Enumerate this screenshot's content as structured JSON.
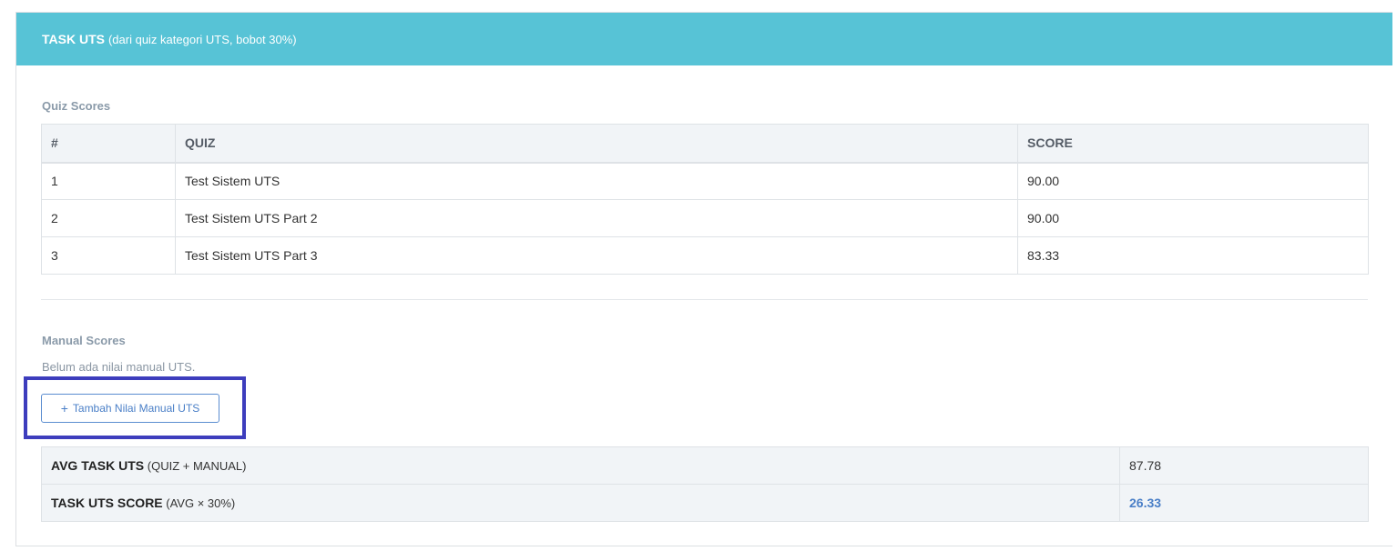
{
  "header": {
    "title": "TASK UTS",
    "subtitle": "(dari quiz kategori UTS, bobot 30%)",
    "color": "#57c3d6"
  },
  "quiz_section": {
    "label": "Quiz Scores",
    "columns": [
      "#",
      "QUIZ",
      "SCORE"
    ],
    "rows": [
      {
        "no": "1",
        "quiz": "Test Sistem UTS",
        "score": "90.00"
      },
      {
        "no": "2",
        "quiz": "Test Sistem UTS Part 2",
        "score": "90.00"
      },
      {
        "no": "3",
        "quiz": "Test Sistem UTS Part 3",
        "score": "83.33"
      }
    ]
  },
  "manual_section": {
    "label": "Manual Scores",
    "empty_text": "Belum ada nilai manual UTS.",
    "add_button_icon": "plus-icon",
    "add_button_label": "Tambah Nilai Manual UTS"
  },
  "summary": {
    "avg_label": "AVG TASK UTS",
    "avg_note": "(QUIZ + MANUAL)",
    "avg_value": "87.78",
    "score_label": "TASK UTS SCORE",
    "score_note": "(AVG × 30%)",
    "score_value": "26.33"
  }
}
